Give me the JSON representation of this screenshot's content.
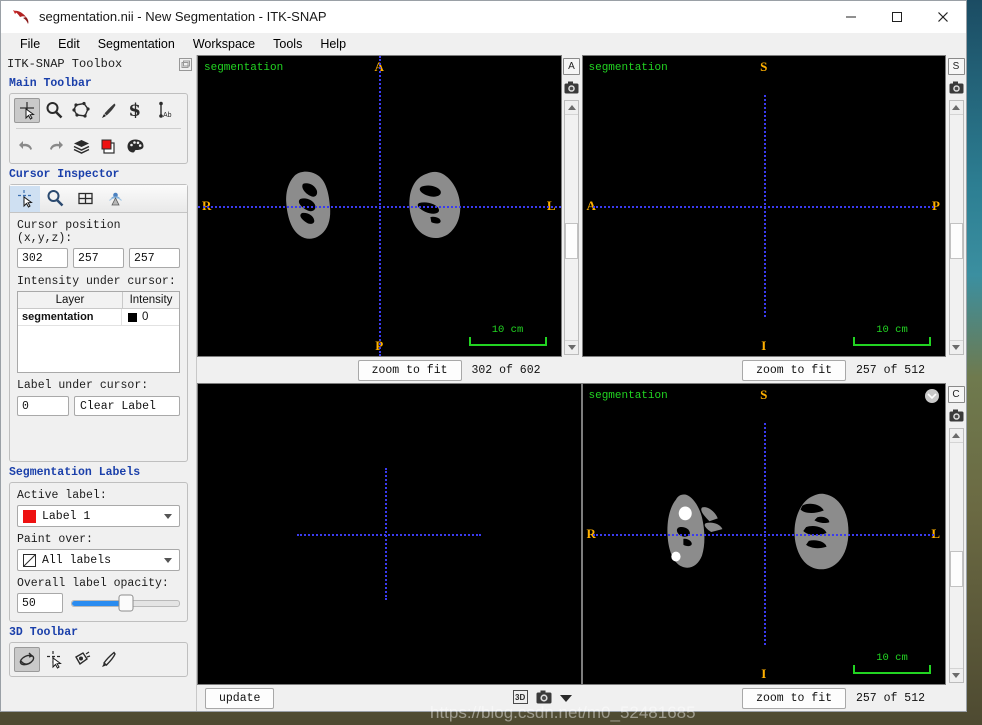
{
  "window": {
    "title": "segmentation.nii - New Segmentation - ITK-SNAP",
    "minimize": "–",
    "maximize": "☐",
    "close": "✕"
  },
  "menu": {
    "items": [
      "File",
      "Edit",
      "Segmentation",
      "Workspace",
      "Tools",
      "Help"
    ]
  },
  "toolbox": {
    "title": "ITK-SNAP Toolbox",
    "undock_icon": "undock-icon",
    "main_toolbar": {
      "title": "Main Toolbar",
      "row1": [
        {
          "name": "crosshair-tool",
          "active": true
        },
        {
          "name": "zoom-pan-tool",
          "active": false
        },
        {
          "name": "polygon-tool",
          "active": false
        },
        {
          "name": "paintbrush-tool",
          "active": false
        },
        {
          "name": "snake-tool",
          "active": false
        },
        {
          "name": "annotation-tool",
          "active": false
        }
      ],
      "row2": [
        {
          "name": "undo-button",
          "active": false
        },
        {
          "name": "redo-button",
          "active": false
        },
        {
          "name": "layer-inspector-button",
          "active": false
        },
        {
          "name": "label-editor-button",
          "active": false
        },
        {
          "name": "appearance-button",
          "active": false
        }
      ]
    },
    "cursor_inspector": {
      "title": "Cursor Inspector",
      "tabs": [
        {
          "name": "tab-cursor",
          "active": true
        },
        {
          "name": "tab-zoom",
          "active": false
        },
        {
          "name": "tab-display-layout",
          "active": false
        },
        {
          "name": "tab-registration",
          "active": false
        }
      ],
      "cursor_position_label": "Cursor position (x,y,z):",
      "cursor_position": {
        "x": "302",
        "y": "257",
        "z": "257"
      },
      "intensity_label": "Intensity under cursor:",
      "table": {
        "headers": [
          "Layer",
          "Intensity"
        ],
        "rows": [
          {
            "layer": "segmentation",
            "intensity": "0",
            "swatch": "#000000"
          }
        ]
      },
      "label_under_cursor_label": "Label under cursor:",
      "label_value": "0",
      "clear_label_button": "Clear Label"
    },
    "segmentation_labels": {
      "title": "Segmentation Labels",
      "active_label_caption": "Active label:",
      "active_label_value": "Label 1",
      "active_label_color": "#ee1111",
      "paint_over_caption": "Paint over:",
      "paint_over_value": "All labels",
      "opacity_caption": "Overall label opacity:",
      "opacity_value": "50",
      "opacity_percent": 50,
      "slider_color": "#2a8cf0"
    },
    "toolbar_3d": {
      "title": "3D Toolbar",
      "buttons": [
        {
          "name": "trackball-tool",
          "active": true
        },
        {
          "name": "crosshair-3d-tool",
          "active": false
        },
        {
          "name": "spray-tool",
          "active": false
        },
        {
          "name": "scalpel-tool",
          "active": false
        }
      ]
    }
  },
  "viewports": [
    {
      "id": "axial",
      "layer_label": "segmentation",
      "orientation": {
        "top": "A",
        "bottom": "P",
        "left": "R",
        "right": "L"
      },
      "scalebar": "10  cm",
      "side_button": "A",
      "camera_icon": "camera-icon",
      "zoom_button": "zoom to fit",
      "slice_text": "302 of 602",
      "has_segmentation": true
    },
    {
      "id": "sagittal",
      "layer_label": "segmentation",
      "orientation": {
        "top": "S",
        "bottom": "I",
        "left": "A",
        "right": "P"
      },
      "scalebar": "10  cm",
      "side_button": "S",
      "camera_icon": "camera-icon",
      "zoom_button": "zoom to fit",
      "slice_text": "257 of 512",
      "has_segmentation": false
    },
    {
      "id": "three-d",
      "layer_label": "",
      "update_button": "update",
      "icons_3d": [
        "3d-icon",
        "camera-icon",
        "chevron-down-icon"
      ],
      "has_segmentation": false
    },
    {
      "id": "coronal",
      "layer_label": "segmentation",
      "orientation": {
        "top": "S",
        "bottom": "I",
        "left": "R",
        "right": "L"
      },
      "scalebar": "10  cm",
      "side_button": "C",
      "camera_icon": "camera-icon",
      "zoom_button": "zoom to fit",
      "slice_text": "257 of 512",
      "has_segmentation": true
    }
  ],
  "watermark": "https://blog.csdn.net/m0_52481685",
  "colors": {
    "crosshair": "#3b3bf0",
    "orientation_text": "#ffb000",
    "layer_text": "#22d422",
    "scalebar": "#22d422",
    "segmentation_gray": "#8c8c8c"
  }
}
